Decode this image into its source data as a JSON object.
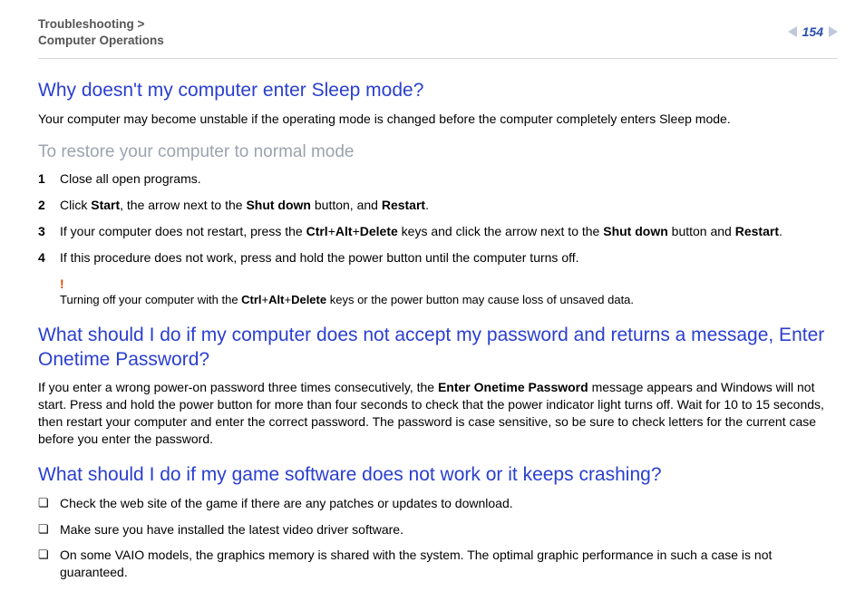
{
  "header": {
    "breadcrumb_line1": "Troubleshooting >",
    "breadcrumb_line2": "Computer Operations",
    "page_number": "154"
  },
  "s1": {
    "title": "Why doesn't my computer enter Sleep mode?",
    "intro": "Your computer may become unstable if the operating mode is changed before the computer completely enters Sleep mode.",
    "subhead": "To restore your computer to normal mode",
    "step1": "Close all open programs.",
    "step2_a": "Click ",
    "step2_b": "Start",
    "step2_c": ", the arrow next to the ",
    "step2_d": "Shut down",
    "step2_e": " button, and ",
    "step2_f": "Restart",
    "step2_g": ".",
    "step3_a": "If your computer does not restart, press the ",
    "step3_b": "Ctrl",
    "step3_c": "+",
    "step3_d": "Alt",
    "step3_e": "+",
    "step3_f": "Delete",
    "step3_g": " keys and click the arrow next to the ",
    "step3_h": "Shut down",
    "step3_i": " button and ",
    "step3_j": "Restart",
    "step3_k": ".",
    "step4": "If this procedure does not work, press and hold the power button until the computer turns off.",
    "note_a": "Turning off your computer with the ",
    "note_b": "Ctrl",
    "note_c": "+",
    "note_d": "Alt",
    "note_e": "+",
    "note_f": "Delete",
    "note_g": " keys or the power button may cause loss of unsaved data."
  },
  "s2": {
    "title": "What should I do if my computer does not accept my password and returns a message, Enter Onetime Password?",
    "p_a": "If you enter a wrong power-on password three times consecutively, the ",
    "p_b": "Enter Onetime Password",
    "p_c": " message appears and Windows will not start. Press and hold the power button for more than four seconds to check that the power indicator light turns off. Wait for 10 to 15 seconds, then restart your computer and enter the correct password. The password is case sensitive, so be sure to check letters for the current case before you enter the password."
  },
  "s3": {
    "title": "What should I do if my game software does not work or it keeps crashing?",
    "b1": "Check the web site of the game if there are any patches or updates to download.",
    "b2": "Make sure you have installed the latest video driver software.",
    "b3": "On some VAIO models, the graphics memory is shared with the system. The optimal graphic performance in such a case is not guaranteed."
  },
  "bullets": {
    "box": "❏"
  },
  "nums": {
    "n1": "1",
    "n2": "2",
    "n3": "3",
    "n4": "4"
  },
  "bang": "!"
}
